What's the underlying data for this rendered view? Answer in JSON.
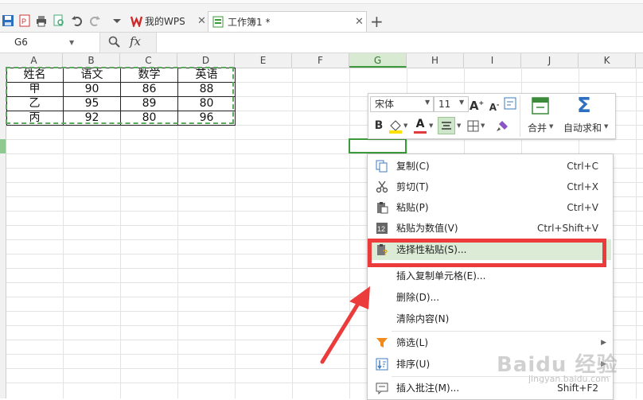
{
  "tabs": [
    {
      "label": "我的WPS",
      "icon": "wps-logo-icon"
    },
    {
      "label": "工作簿1 *",
      "icon": "spreadsheet-icon"
    }
  ],
  "formula_bar": {
    "name_box": "G6",
    "fx_label": "fx"
  },
  "columns": [
    "A",
    "B",
    "C",
    "D",
    "E",
    "F",
    "G",
    "H",
    "I",
    "J",
    "K"
  ],
  "selected_column": "G",
  "table": {
    "headers": [
      "姓名",
      "语文",
      "数学",
      "英语"
    ],
    "rows": [
      [
        "甲",
        "90",
        "86",
        "88"
      ],
      [
        "乙",
        "95",
        "89",
        "80"
      ],
      [
        "丙",
        "92",
        "80",
        "96"
      ]
    ]
  },
  "mini_toolbar": {
    "font_name": "宋体",
    "font_size": "11",
    "bold": "B",
    "font_color_letter": "A",
    "merge_label": "合并",
    "autosum_label": "自动求和"
  },
  "context_menu": [
    {
      "label": "复制(C)",
      "shortcut": "Ctrl+C",
      "icon": "copy-icon"
    },
    {
      "label": "剪切(T)",
      "shortcut": "Ctrl+X",
      "icon": "scissors-icon"
    },
    {
      "label": "粘贴(P)",
      "shortcut": "Ctrl+V",
      "icon": "paste-icon"
    },
    {
      "label": "粘贴为数值(V)",
      "shortcut": "Ctrl+Shift+V",
      "icon": "paste-values-icon"
    },
    {
      "label": "选择性粘贴(S)...",
      "shortcut": "",
      "icon": "paste-special-icon"
    },
    {
      "label": "插入复制单元格(E)...",
      "shortcut": "",
      "icon": ""
    },
    {
      "label": "删除(D)...",
      "shortcut": "",
      "icon": ""
    },
    {
      "label": "清除内容(N)",
      "shortcut": "",
      "icon": ""
    },
    {
      "label": "筛选(L)",
      "shortcut": "",
      "icon": "filter-icon"
    },
    {
      "label": "排序(U)",
      "shortcut": "",
      "icon": "sort-icon"
    },
    {
      "label": "插入批注(M)...",
      "shortcut": "Shift+F2",
      "icon": "comment-icon"
    }
  ],
  "colors": {
    "accent_green": "#3b9b3b",
    "highlight_red": "#ec3b3b",
    "menu_hover": "#dcebd5"
  },
  "watermark": {
    "brand": "Baidu 经验",
    "url": "jingyan.baidu.com"
  }
}
